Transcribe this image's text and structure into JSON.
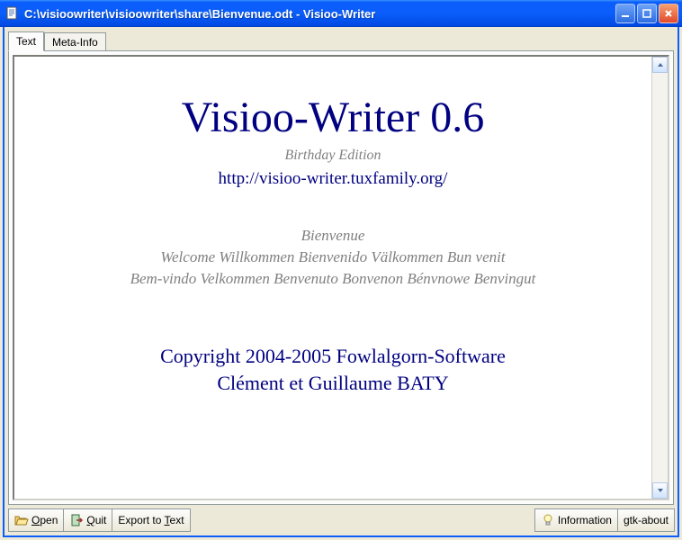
{
  "window": {
    "title": "C:\\visioowriter\\visioowriter\\share\\Bienvenue.odt - Visioo-Writer"
  },
  "tabs": {
    "text": "Text",
    "meta": "Meta-Info"
  },
  "document": {
    "title": "Visioo-Writer 0.6",
    "subtitle": "Birthday Edition",
    "link": "http://visioo-writer.tuxfamily.org/",
    "welcome_line1": "Bienvenue",
    "welcome_line2": "Welcome Willkommen Bienvenido Välkommen Bun venit",
    "welcome_line3": "Bem-vindo Velkommen Benvenuto Bonvenon Bénvnowe Benvingut",
    "copyright_line1": "Copyright 2004-2005 Fowlalgorn-Software",
    "copyright_line2": "Clément et Guillaume BATY"
  },
  "toolbar": {
    "open_label": "Open",
    "quit_label": "Quit",
    "export_label_pre": "Export to ",
    "export_label_u": "T",
    "export_label_post": "ext",
    "info_label": "Information",
    "about_label": "gtk-about"
  }
}
